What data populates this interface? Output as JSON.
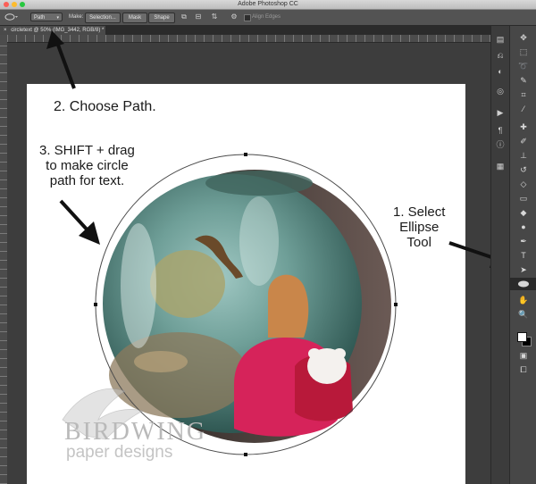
{
  "app": {
    "title": "Adobe Photoshop CC"
  },
  "window": {
    "traffic_colors": [
      "#fc5f57",
      "#fdbc2e",
      "#28c840"
    ]
  },
  "options_bar": {
    "tool_mode_icon": "ellipse-icon",
    "mode_select": "Path",
    "make_label": "Make:",
    "selection_button": "Selection...",
    "mask_button": "Mask",
    "shape_button": "Shape",
    "align_edges_label": "Align Edges",
    "align_edges_checked": false
  },
  "document_tab": {
    "label": "circletext @ 50% (IMG_3442, RGB/8) *",
    "close_glyph": "×"
  },
  "annotations": {
    "step1": "1. Select\nEllipse\nTool",
    "step2": "2. Choose Path.",
    "step3": "3. SHIFT + drag\nto make circle\npath for text."
  },
  "watermark": {
    "line1": "BIRDWING",
    "line2": "paper designs"
  },
  "toolbar": {
    "tools": [
      "move-icon",
      "marquee-icon",
      "lasso-icon",
      "quick-select-icon",
      "crop-icon",
      "eyedropper-icon",
      "healing-brush-icon",
      "brush-icon",
      "clone-stamp-icon",
      "history-brush-icon",
      "eraser-icon",
      "gradient-icon",
      "blur-icon",
      "dodge-icon",
      "pen-icon",
      "type-icon",
      "path-select-icon",
      "ellipse-tool-icon",
      "hand-icon",
      "zoom-icon"
    ],
    "active_tool": "ellipse-tool-icon"
  },
  "colors": {
    "accent_arrow": "#111111",
    "canvas": "#ffffff",
    "ui_dark": "#3b3b3b"
  }
}
